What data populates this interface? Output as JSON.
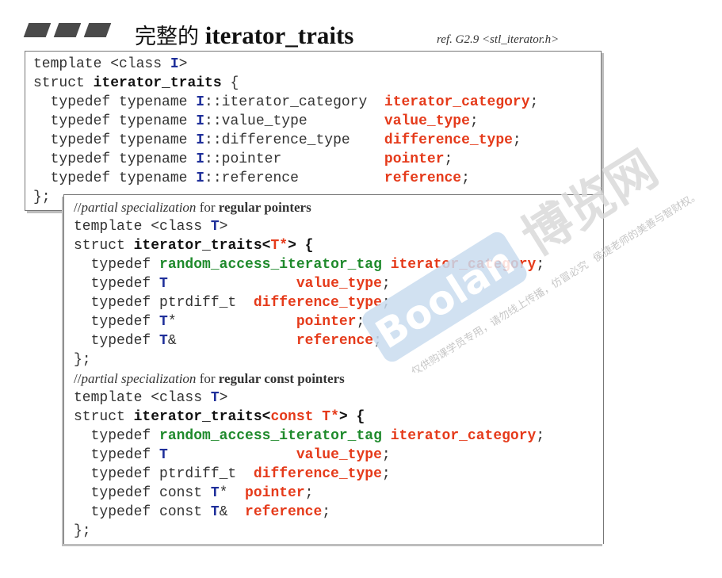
{
  "header": {
    "title_cn": "完整的",
    "title_en": "iterator_traits",
    "ref": "ref. G2.9 <stl_iterator.h>"
  },
  "box1": {
    "l1_a": "template <class ",
    "l1_b": "I",
    "l1_c": ">",
    "l2_a": "struct ",
    "l2_b": "iterator_traits",
    "l2_c": " {",
    "td": [
      {
        "pre": "  typedef typename ",
        "t": "I",
        "mid": "::iterator_category  ",
        "name": "iterator_category",
        "end": ";"
      },
      {
        "pre": "  typedef typename ",
        "t": "I",
        "mid": "::value_type         ",
        "name": "value_type",
        "end": ";"
      },
      {
        "pre": "  typedef typename ",
        "t": "I",
        "mid": "::difference_type    ",
        "name": "difference_type",
        "end": ";"
      },
      {
        "pre": "  typedef typename ",
        "t": "I",
        "mid": "::pointer            ",
        "name": "pointer",
        "end": ";"
      },
      {
        "pre": "  typedef typename ",
        "t": "I",
        "mid": "::reference          ",
        "name": "reference",
        "end": ";"
      }
    ],
    "close": "};"
  },
  "box2": {
    "c1_a": "//",
    "c1_i": "partial specialization",
    "c1_b": " for ",
    "c1_c": "regular pointers",
    "p_tpl_a": "template <class ",
    "p_tpl_b": "T",
    "p_tpl_c": ">",
    "p_st_a": "struct ",
    "p_st_b": "iterator_traits<",
    "p_st_c": "T*",
    "p_st_d": "> {",
    "p1_a": "  typedef ",
    "p1_g": "random_access_iterator_tag",
    "p1_b": " ",
    "p1_r": "iterator_category",
    "p1_e": ";",
    "p2_a": "  typedef ",
    "p2_t": "T",
    "p2_b": "               ",
    "p2_r": "value_type",
    "p2_e": ";",
    "p3_a": "  typedef ptrdiff_t  ",
    "p3_r": "difference_type",
    "p3_e": ";",
    "p4_a": "  typedef ",
    "p4_t": "T",
    "p4_b": "*              ",
    "p4_r": "pointer",
    "p4_e": ";",
    "p5_a": "  typedef ",
    "p5_t": "T",
    "p5_b": "&              ",
    "p5_r": "reference",
    "p5_e": ";",
    "p_close": "};",
    "c2_a": "//",
    "c2_i": "partial specialization",
    "c2_b": " for ",
    "c2_c": "regular const pointers",
    "q_tpl_a": "template <class ",
    "q_tpl_b": "T",
    "q_tpl_c": ">",
    "q_st_a": "struct ",
    "q_st_b": "iterator_traits<",
    "q_st_c": "const ",
    "q_st_t": "T*",
    "q_st_d": "> {",
    "q1_a": "  typedef ",
    "q1_g": "random_access_iterator_tag",
    "q1_b": " ",
    "q1_r": "iterator_category",
    "q1_e": ";",
    "q2_a": "  typedef ",
    "q2_t": "T",
    "q2_b": "               ",
    "q2_r": "value_type",
    "q2_e": ";",
    "q3_a": "  typedef ptrdiff_t  ",
    "q3_r": "difference_type",
    "q3_e": ";",
    "q4_a": "  typedef const ",
    "q4_t": "T",
    "q4_b": "*  ",
    "q4_r": "pointer",
    "q4_e": ";",
    "q5_a": "  typedef const ",
    "q5_t": "T",
    "q5_b": "&  ",
    "q5_r": "reference",
    "q5_e": ";",
    "q_close": "};"
  },
  "watermark": {
    "cn": "博览网",
    "logo": "Boolan",
    "notice1": "仅供购课学员专用，请勿线上传播，仿冒必究",
    "notice2": "侯捷老师的美善与智财权。"
  }
}
